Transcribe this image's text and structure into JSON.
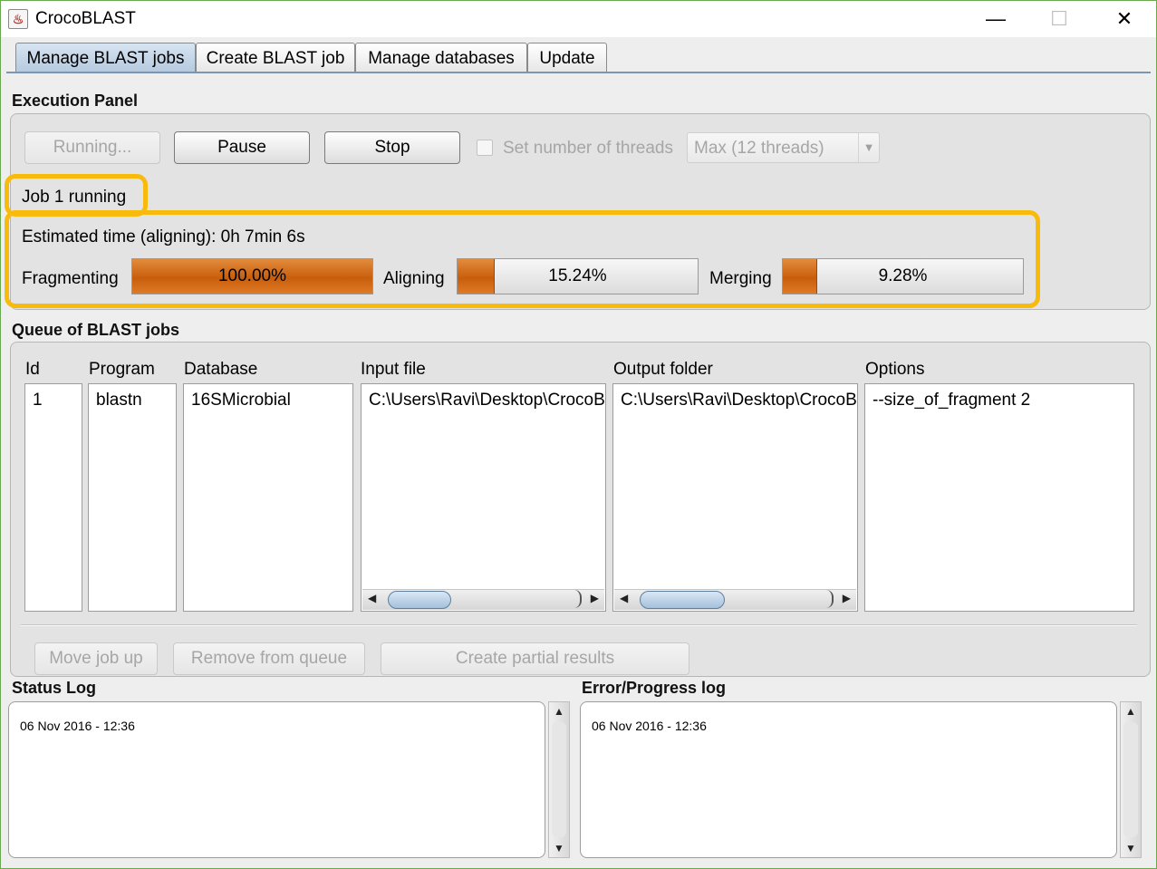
{
  "window": {
    "title": "CrocoBLAST",
    "icon": "java-cup-icon",
    "controls": {
      "minimize": "—",
      "maximize": "☐",
      "close": "✕"
    }
  },
  "tabs": [
    {
      "label": "Manage BLAST jobs",
      "active": true
    },
    {
      "label": "Create BLAST job",
      "active": false
    },
    {
      "label": "Manage databases",
      "active": false
    },
    {
      "label": "Update",
      "active": false
    }
  ],
  "execution_panel": {
    "title": "Execution Panel",
    "running_button": "Running...",
    "pause_button": "Pause",
    "stop_button": "Stop",
    "threads_checkbox_label": "Set number of threads",
    "threads_checked": false,
    "threads_select_value": "Max (12 threads)",
    "job_status": "Job 1 running",
    "estimated_time": "Estimated time (aligning): 0h 7min 6s",
    "progress": [
      {
        "label": "Fragmenting",
        "value": 100.0,
        "text": "100.00%"
      },
      {
        "label": "Aligning",
        "value": 15.24,
        "text": "15.24%"
      },
      {
        "label": "Merging",
        "value": 9.28,
        "text": "9.28%"
      }
    ],
    "highlight_color": "#f8bb0b",
    "progress_color": "#d46a12"
  },
  "queue": {
    "title": "Queue of BLAST jobs",
    "columns": {
      "id": "Id",
      "program": "Program",
      "database": "Database",
      "input_file": "Input file",
      "output_folder": "Output folder",
      "options": "Options"
    },
    "row": {
      "id": "1",
      "program": "blastn",
      "database": "16SMicrobial",
      "input_file": "C:\\Users\\Ravi\\Desktop\\CrocoB",
      "output_folder": "C:\\Users\\Ravi\\Desktop\\CrocoB",
      "options": "--size_of_fragment 2"
    },
    "move_up_button": "Move job up",
    "remove_button": "Remove from queue",
    "partial_results_button": "Create partial results"
  },
  "status_log": {
    "title": "Status Log",
    "text": "06 Nov 2016 - 12:36"
  },
  "error_log": {
    "title": "Error/Progress log",
    "text": "06 Nov 2016 - 12:36"
  }
}
